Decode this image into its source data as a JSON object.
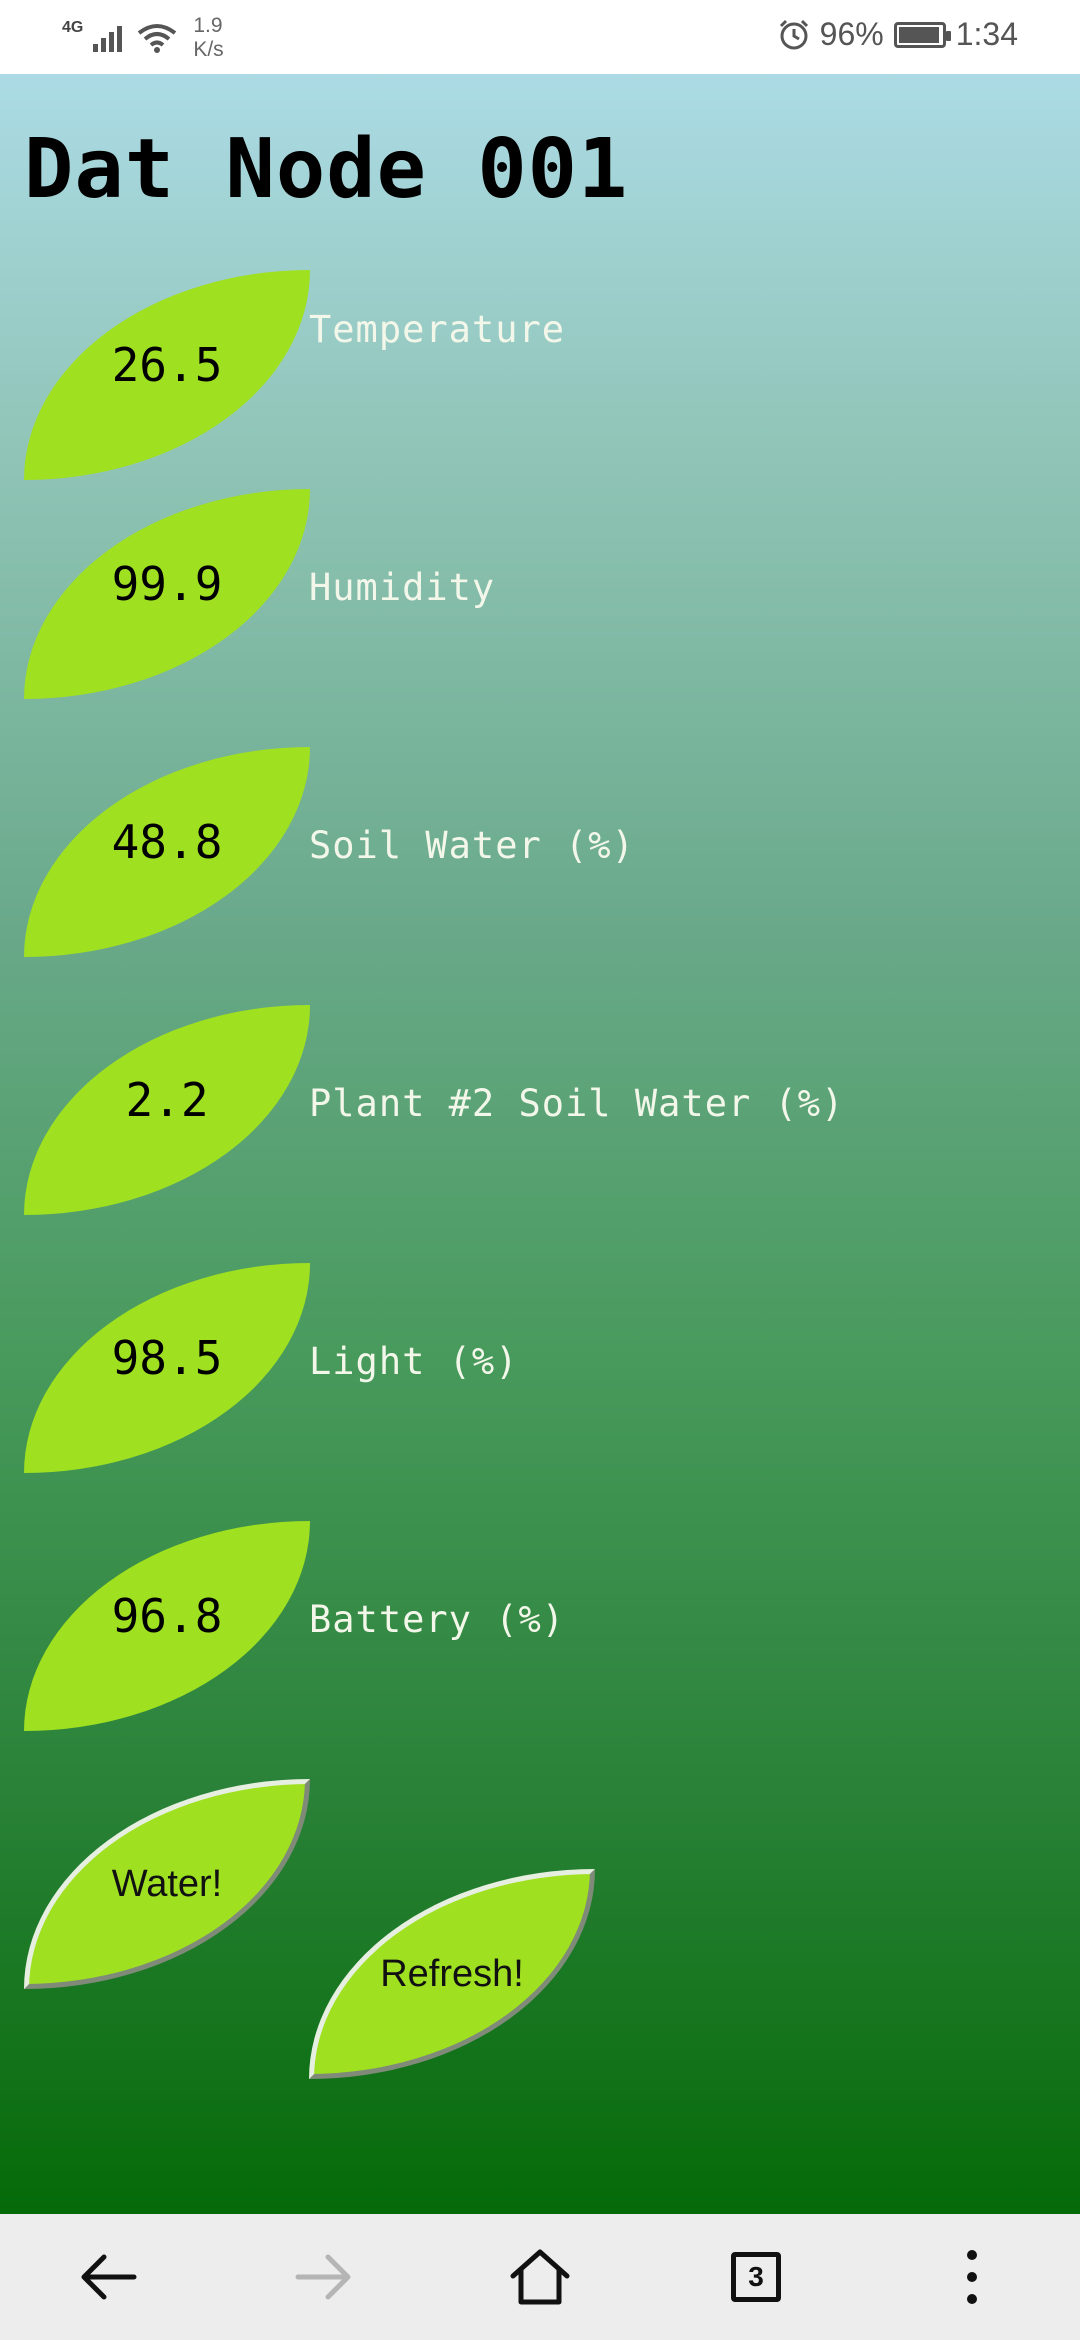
{
  "status_bar": {
    "network": "4G",
    "speed": "1.9\nK/s",
    "battery": "96%",
    "time": "1:34",
    "battery_level": 0.96
  },
  "page": {
    "title": "Dat Node 001"
  },
  "readings": [
    {
      "value": "26.5",
      "label": "Temperature"
    },
    {
      "value": "99.9",
      "label": "Humidity"
    },
    {
      "value": "48.8",
      "label": "Soil Water (%)"
    },
    {
      "value": "2.2",
      "label": "Plant #2 Soil Water (%)"
    },
    {
      "value": "98.5",
      "label": "Light (%)"
    },
    {
      "value": "96.8",
      "label": "Battery (%)"
    }
  ],
  "buttons": {
    "water": "Water!",
    "refresh": "Refresh!"
  },
  "nav": {
    "tabs_count": "3",
    "icons": [
      "back-arrow-icon",
      "forward-arrow-icon",
      "home-icon",
      "tabs-icon",
      "more-vert-icon"
    ],
    "colors": {
      "active": "#111111",
      "disabled": "#b5b5b5"
    }
  },
  "colors": {
    "leaf": "#9fe021",
    "label_text": "#f3f7ea",
    "gradient_top": "#acdbe5",
    "gradient_bottom": "#056a08"
  }
}
